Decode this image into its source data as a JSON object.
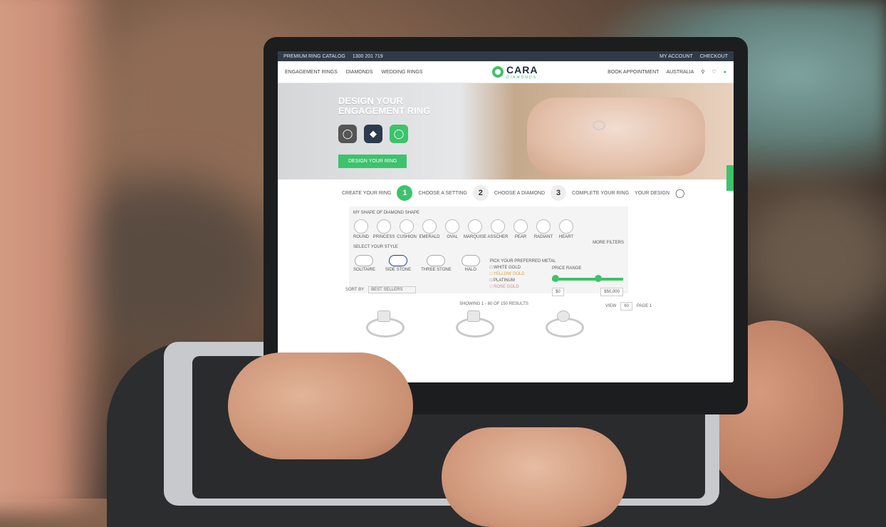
{
  "site": {
    "topbar": {
      "left": [
        "PREMIUM RING CATALOG",
        "1300 201 719"
      ],
      "right": [
        "MY ACCOUNT",
        "CHECKOUT"
      ]
    },
    "nav": {
      "left": [
        "ENGAGEMENT RINGS",
        "DIAMONDS",
        "WEDDING RINGS"
      ],
      "logo_text": "CARA",
      "logo_sub": "DIAMONDS",
      "right": [
        "BOOK APPOINTMENT",
        "AUSTRALIA"
      ]
    },
    "hero": {
      "title_line1": "DESIGN YOUR",
      "title_line2": "ENGAGEMENT RING",
      "button": "DESIGN YOUR RING",
      "icons": [
        "ring-icon",
        "diamond-icon",
        "ring-icon"
      ]
    },
    "steps": {
      "intro": "CREATE YOUR RING",
      "items": [
        {
          "num": "1",
          "label": "CHOOSE A SETTING"
        },
        {
          "num": "2",
          "label": "CHOOSE A DIAMOND"
        },
        {
          "num": "3",
          "label": "COMPLETE YOUR RING"
        }
      ],
      "end": "YOUR DESIGN"
    },
    "filters": {
      "shape_title": "MY SHAPE OF DIAMOND SHAPE",
      "shapes": [
        "ROUND",
        "PRINCESS",
        "CUSHION",
        "EMERALD",
        "OVAL",
        "MARQUISE",
        "ASSCHER",
        "PEAR",
        "RADIANT",
        "HEART"
      ],
      "more": "MORE FILTERS",
      "style_title": "SELECT YOUR STYLE",
      "styles": [
        "SOLITAIRE",
        "SIDE STONE",
        "THREE STONE",
        "HALO"
      ],
      "metal_title": "PICK YOUR PREFERRED METAL",
      "metals": [
        "WHITE GOLD",
        "YELLOW GOLD",
        "PLATINUM",
        "ROSE GOLD"
      ],
      "price_title": "PRICE RANGE",
      "price_min": "$0",
      "price_max": "$50,000"
    },
    "results": {
      "sort_label": "SORT BY",
      "sort_value": "BEST SELLERS",
      "count_text": "SHOWING 1 - 60 OF 150 RESULTS",
      "per_page_label": "VIEW",
      "per_page_value": "60",
      "page_label": "PAGE 1"
    }
  }
}
